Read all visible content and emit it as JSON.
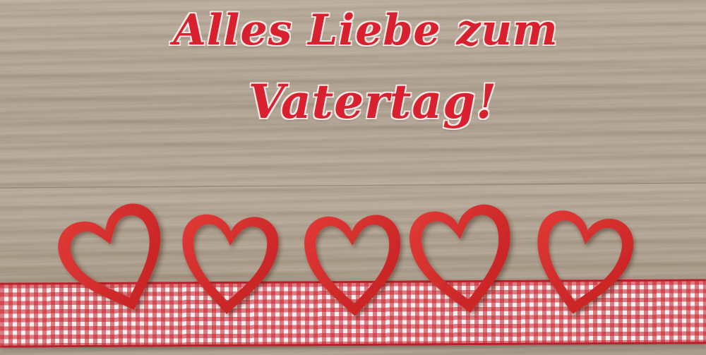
{
  "greeting": {
    "line1": "Alles Liebe zum",
    "line2": "Vatertag!"
  },
  "colors": {
    "text": "#d9202e",
    "heart": "#d42a2a",
    "ribbon_check": "#c81e28",
    "wood": "#b0a290"
  },
  "hearts": [
    {
      "name": "heart-1"
    },
    {
      "name": "heart-2"
    },
    {
      "name": "heart-3"
    },
    {
      "name": "heart-4"
    },
    {
      "name": "heart-5"
    }
  ]
}
